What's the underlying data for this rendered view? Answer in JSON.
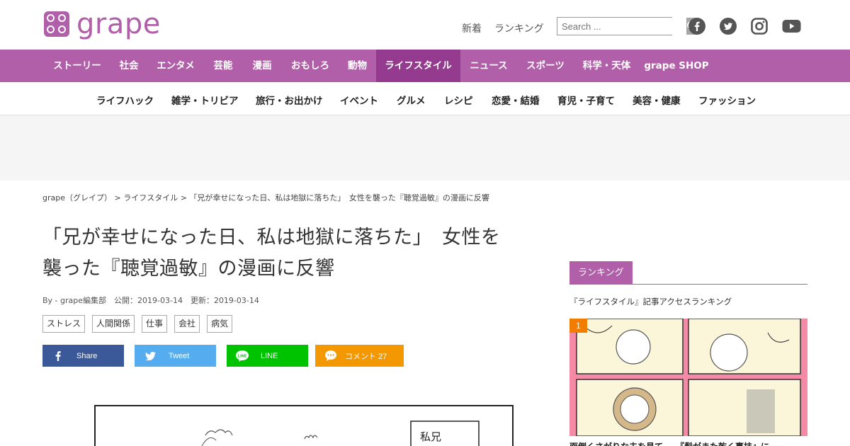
{
  "header": {
    "logo_text": "grape",
    "links": [
      "新着",
      "ランキング"
    ],
    "search_placeholder": "Search ...",
    "social_icons": [
      "facebook-icon",
      "twitter-icon",
      "instagram-icon",
      "youtube-icon"
    ]
  },
  "main_nav": {
    "items": [
      "ストーリー",
      "社会",
      "エンタメ",
      "芸能",
      "漫画",
      "おもしろ",
      "動物",
      "ライフスタイル",
      "ニュース",
      "スポーツ",
      "科学・天体",
      "grape SHOP"
    ],
    "active": "ライフスタイル",
    "color": "#b05fa8",
    "active_color": "#943b8f"
  },
  "sub_nav": {
    "items": [
      "ライフハック",
      "雑学・トリビア",
      "旅行・お出かけ",
      "イベント",
      "グルメ",
      "レシピ",
      "恋愛・結婚",
      "育児・子育て",
      "美容・健康",
      "ファッション"
    ]
  },
  "breadcrumb": "grape（グレイプ） > ライフスタイル > 「兄が幸せになった日、私は地獄に落ちた」　女性を襲った『聴覚過敏』の漫画に反響",
  "article": {
    "title_line1": "「兄が幸せになった日、私は地獄に落ちた」　女性を",
    "title_line2": "襲った『聴覚過敏』の漫画に反響",
    "meta": "By - grape編集部　公開：2019-03-14　更新：2019-03-14",
    "tags": [
      "ストレス",
      "人間関係",
      "仕事",
      "会社",
      "病気"
    ]
  },
  "share": {
    "facebook": "Share",
    "twitter": "Tweet",
    "line": "LINE",
    "comment": "コメント 27",
    "colors": {
      "facebook": "#3b5998",
      "twitter": "#55acee",
      "line": "#00c300",
      "comment": "#f39800"
    }
  },
  "comic": {
    "text": "私兄"
  },
  "sidebar": {
    "ranking_label": "ランキング",
    "ranking_sub": "『ライフスタイル』記事アクセスランキング",
    "first_rank": "1",
    "first_caption": "面倒くさがりな夫を見て…　『髪がまた乾く裏技』に"
  }
}
